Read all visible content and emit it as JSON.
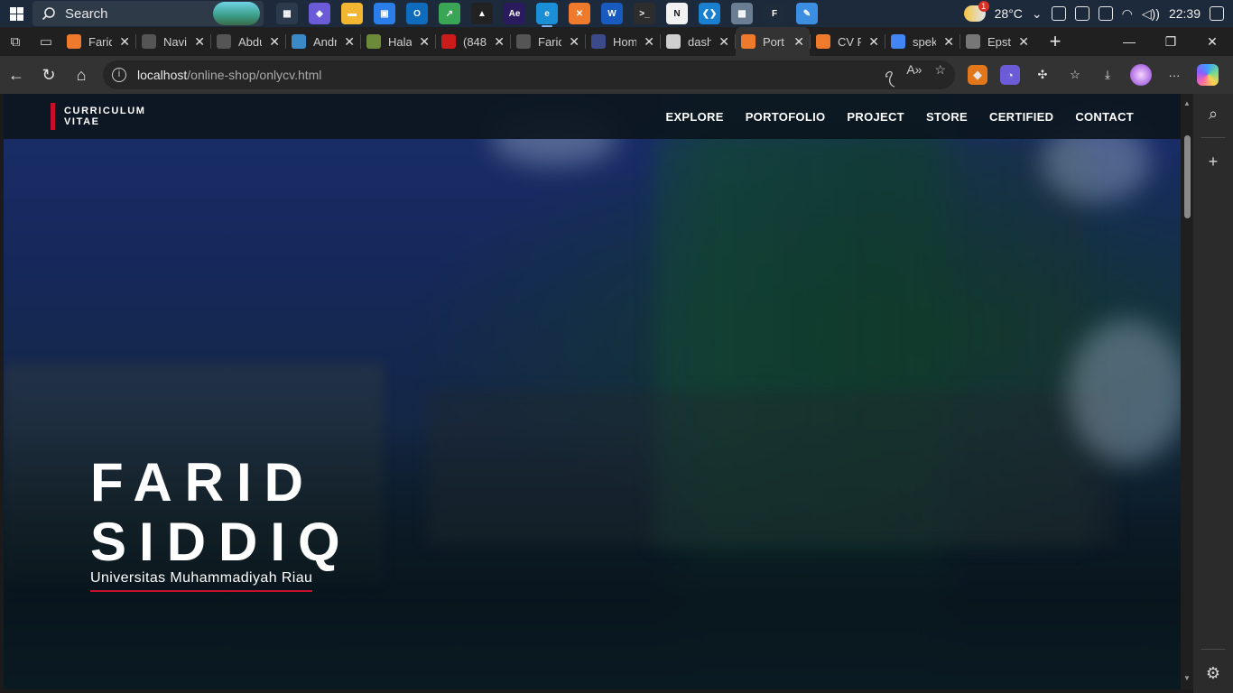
{
  "taskbar": {
    "search_label": "Search",
    "apps": [
      {
        "icon": "widgets-icon",
        "color": "#2b3a4c",
        "glyph": "▦"
      },
      {
        "icon": "copilot-app-icon",
        "color": "#6b5bd6",
        "glyph": "◆"
      },
      {
        "icon": "file-explorer-icon",
        "color": "#f2b632",
        "glyph": "▬"
      },
      {
        "icon": "store-icon",
        "color": "#2b7de9",
        "glyph": "▣"
      },
      {
        "icon": "outlook-icon",
        "color": "#0f6cbd",
        "glyph": "O"
      },
      {
        "icon": "stats-app-icon",
        "color": "#3aa655",
        "glyph": "↗"
      },
      {
        "icon": "linux-icon",
        "color": "#222",
        "glyph": "▲"
      },
      {
        "icon": "after-effects-icon",
        "color": "#2a1a5e",
        "glyph": "Ae"
      },
      {
        "icon": "edge-icon",
        "color": "#1a8fd6",
        "glyph": "e",
        "active": true
      },
      {
        "icon": "xampp-icon",
        "color": "#f07a2c",
        "glyph": "✕"
      },
      {
        "icon": "word-icon",
        "color": "#185abd",
        "glyph": "W"
      },
      {
        "icon": "terminal-icon",
        "color": "#2d2d2d",
        "glyph": ">_"
      },
      {
        "icon": "notion-icon",
        "color": "#f2f2f2",
        "glyph": "N"
      },
      {
        "icon": "vscode-icon",
        "color": "#1b7fcf",
        "glyph": "❮❯"
      },
      {
        "icon": "photos-icon",
        "color": "#6a7d92",
        "glyph": "▩"
      },
      {
        "icon": "fox-icon",
        "color": "#1d2b3a",
        "glyph": "F"
      },
      {
        "icon": "paint-icon",
        "color": "#3c8ee0",
        "glyph": "✎"
      }
    ],
    "temperature": "28°C",
    "weather_badge": "1",
    "clock": "22:39"
  },
  "tabs": [
    {
      "title": "Farid",
      "fav": "#f07a2c"
    },
    {
      "title": "Navi",
      "fav": "#555"
    },
    {
      "title": "Abdu",
      "fav": "#555"
    },
    {
      "title": "Andr",
      "fav": "#3a8ac8"
    },
    {
      "title": "Halar",
      "fav": "#6b8a3a"
    },
    {
      "title": "(848",
      "fav": "#cc1b1b"
    },
    {
      "title": "Farid",
      "fav": "#555"
    },
    {
      "title": "Hom",
      "fav": "#3b4a8a"
    },
    {
      "title": "dash",
      "fav": "#cfcfcf"
    },
    {
      "title": "Port",
      "fav": "#f07a2c",
      "active": true
    },
    {
      "title": "CV F",
      "fav": "#f07a2c"
    },
    {
      "title": "spek",
      "fav": "#4285f4"
    },
    {
      "title": "Epst",
      "fav": "#777"
    }
  ],
  "address": {
    "host": "localhost",
    "path": "/online-shop/onlycv.html"
  },
  "site": {
    "brand_line1": "CURRICULUM",
    "brand_line2": "VITAE",
    "menu": [
      "EXPLORE",
      "PORTOFOLIO",
      "PROJECT",
      "STORE",
      "CERTIFIED",
      "CONTACT"
    ],
    "hero_first": "FARID",
    "hero_last": "SIDDIQ",
    "hero_sub": "Universitas Muhammadiyah Riau"
  },
  "colors": {
    "accent": "#c8102e",
    "nav_bg": "#0c161e",
    "hero_sky": "#1a2e6a"
  }
}
